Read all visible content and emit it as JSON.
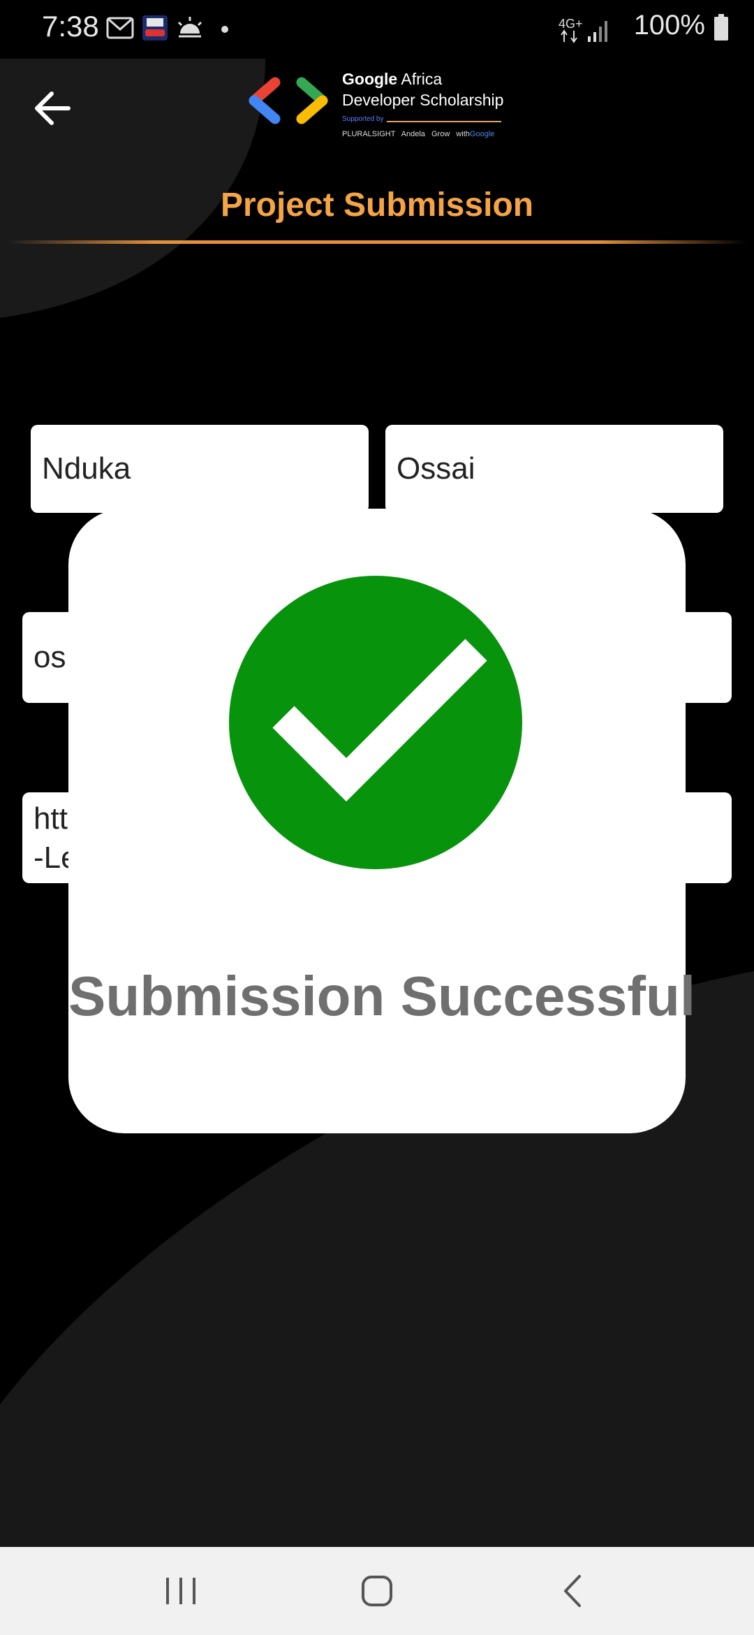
{
  "status_bar": {
    "time": "7:38",
    "network": "4G+",
    "battery": "100%"
  },
  "header": {
    "logo": {
      "brand": "Google",
      "line1_rest": " Africa",
      "line2": "Developer Scholarship",
      "supported_by": "Supported by",
      "partners": [
        "PLURALSIGHT",
        "Andela",
        "Grow with",
        "Google"
      ]
    },
    "title": "Project Submission"
  },
  "form": {
    "first_name": "Nduka",
    "last_name": "Ossai",
    "email_partial": "os",
    "link_partial": "htt\n-Le"
  },
  "dialog": {
    "message": "Submission Successful",
    "badge_color": "#07930c"
  },
  "colors": {
    "accent": "#f5a445",
    "background": "#000000",
    "success": "#07930c"
  },
  "nav": {
    "icons": [
      "recents-icon",
      "home-icon",
      "back-icon"
    ]
  }
}
